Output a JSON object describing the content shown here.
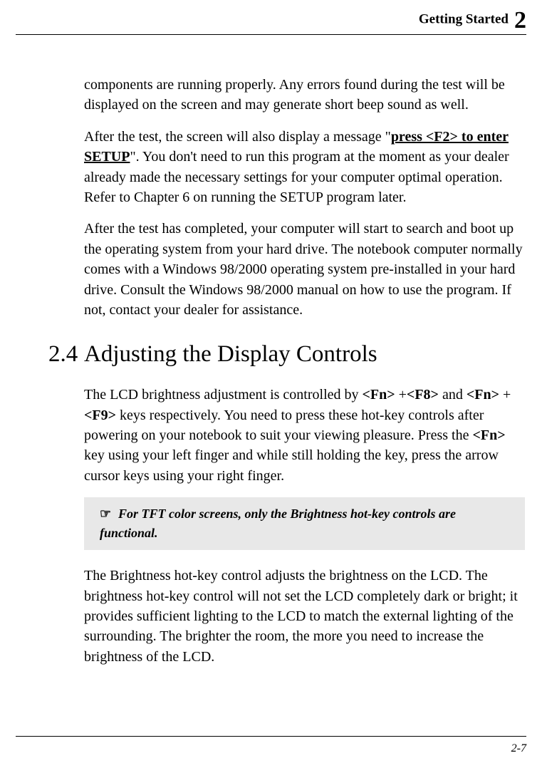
{
  "header": {
    "title": "Getting Started",
    "chapnum": "2"
  },
  "paras": {
    "p1": "components are running properly. Any errors found during the test will be displayed on the screen and may generate short beep sound as well.",
    "p2a": "After the test, the screen will also display a message \"",
    "p2bold": "press <F2> to enter SETUP",
    "p2b": "\". You don't need to run this program at the moment as your dealer already made the necessary settings for your computer        optimal operation. Refer to Chapter 6 on running the SETUP program later.",
    "p3": "After the test has completed, your computer will start to search and boot up the operating system from your hard drive. The notebook computer normally comes with a Windows 98/2000 operating system pre-installed in your hard drive. Consult the Windows 98/2000 manual on how to use the program. If not, contact your dealer for assistance.",
    "p4a": "The LCD brightness adjustment is controlled by ",
    "k1": "<Fn>",
    "plus1": " +",
    "k2": "<F8>",
    "mid1": " and ",
    "k3": "<Fn>",
    "plus2": " + ",
    "k4": "<F9>",
    "p4b": " keys respectively. You need to press these hot-key controls after powering on your notebook to suit your viewing pleasure. Press the ",
    "k5": "<Fn>",
    "p4c": " key using your left finger and while still holding the key, press the arrow cursor keys using your right finger.",
    "note_icon": "☞",
    "note": "For TFT color screens, only the Brightness hot-key controls are functional.",
    "p5": "The Brightness hot-key control adjusts the brightness on the LCD. The brightness hot-key control will not set the LCD completely dark or bright; it provides sufficient lighting to the LCD to match the external lighting of the surrounding. The brighter the room, the more you need to increase the brightness of the LCD."
  },
  "section": {
    "num": "2.4",
    "title": "Adjusting the Display Controls"
  },
  "footer": {
    "pagenum": "2-7"
  }
}
